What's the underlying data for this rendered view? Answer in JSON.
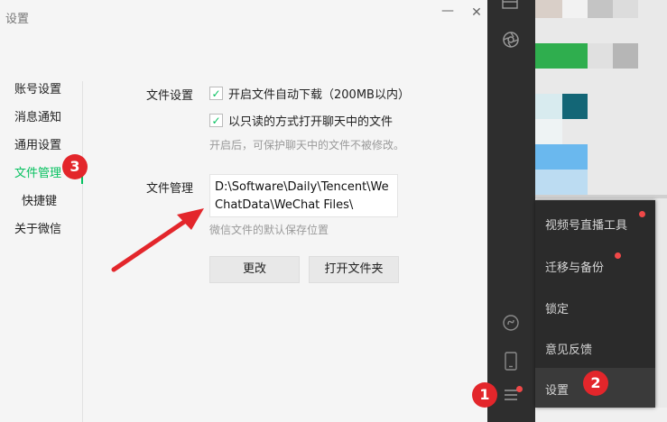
{
  "dialog": {
    "title": "设置",
    "minimize_glyph": "—",
    "close_glyph": "✕"
  },
  "nav": {
    "items": [
      {
        "label": "账号设置"
      },
      {
        "label": "消息通知"
      },
      {
        "label": "通用设置"
      },
      {
        "label": "文件管理"
      },
      {
        "label": "快捷键"
      },
      {
        "label": "关于微信"
      }
    ],
    "active": "文件管理"
  },
  "file_settings": {
    "label": "文件设置",
    "auto_download": {
      "checked": true,
      "label": "开启文件自动下载（200MB以内）"
    },
    "readonly_open": {
      "checked": true,
      "label": "以只读的方式打开聊天中的文件"
    },
    "hint": "开启后，可保护聊天中的文件不被修改。"
  },
  "file_management": {
    "label": "文件管理",
    "path": "D:\\Software\\Daily\\Tencent\\WeChatData\\WeChat Files\\",
    "hint": "微信文件的默认保存位置",
    "change_button": "更改",
    "open_folder_button": "打开文件夹"
  },
  "menu": {
    "items": [
      {
        "label": "视频号直播工具",
        "dot": true
      },
      {
        "label": "迁移与备份",
        "dot": true
      },
      {
        "label": "锁定",
        "dot": false
      },
      {
        "label": "意见反馈",
        "dot": false
      },
      {
        "label": "设置",
        "dot": false
      }
    ]
  },
  "annotations": {
    "step1": "1",
    "step2": "2",
    "step3": "3",
    "color": "#e3262b"
  },
  "icons": [
    "minimize-icon",
    "close-icon",
    "checkmark-icon",
    "menu-icon",
    "mini-program-icon",
    "phone-icon",
    "moments-icon",
    "favorites-icon"
  ],
  "colors": {
    "accent": "#07c160",
    "badge": "#e3262b",
    "sidebar": "#2e2e2e",
    "menu": "#2b2b2b"
  }
}
